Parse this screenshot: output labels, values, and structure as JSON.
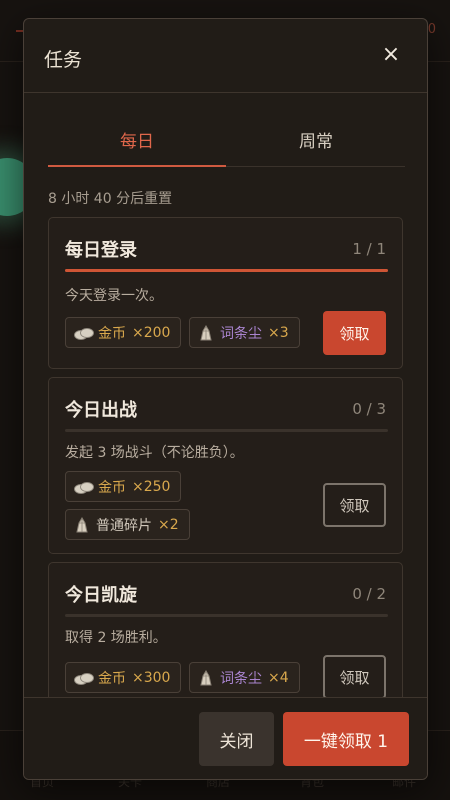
{
  "background": {
    "nav": [
      "首页",
      "关卡",
      "商店",
      "背包",
      "邮件"
    ],
    "header_right": "0"
  },
  "modal": {
    "title": "任务",
    "close_glyph": "×",
    "tabs": [
      {
        "label": "每日",
        "active": true
      },
      {
        "label": "周常",
        "active": false
      }
    ],
    "reset_text": "8 小时 40 分后重置",
    "tasks": [
      {
        "title": "每日登录",
        "progress": "1 / 1",
        "progress_fraction": 1.0,
        "desc": "今天登录一次。",
        "rewards": [
          {
            "icon": "coin-icon",
            "name": "金币",
            "qty": "×200"
          },
          {
            "icon": "crystal-icon",
            "name": "词条尘",
            "qty": "×3"
          }
        ],
        "button": "领取",
        "claimable": true
      },
      {
        "title": "今日出战",
        "progress": "0 / 3",
        "progress_fraction": 0.0,
        "desc": "发起 3 场战斗（不论胜负）。",
        "rewards": [
          {
            "icon": "coin-icon",
            "name": "金币",
            "qty": "×250"
          },
          {
            "icon": "crystal-icon",
            "name": "普通碎片",
            "qty": "×2"
          }
        ],
        "button": "领取",
        "claimable": false
      },
      {
        "title": "今日凯旋",
        "progress": "0 / 2",
        "progress_fraction": 0.0,
        "desc": "取得 2 场胜利。",
        "rewards": [
          {
            "icon": "coin-icon",
            "name": "金币",
            "qty": "×300"
          },
          {
            "icon": "crystal-icon",
            "name": "词条尘",
            "qty": "×4"
          }
        ],
        "button": "领取",
        "claimable": false
      }
    ],
    "footer": {
      "close_label": "关闭",
      "claim_all_label": "一键领取 1"
    }
  },
  "colors": {
    "accent": "#c9472f",
    "gold": "#d9a84d",
    "purple": "#a984cf"
  }
}
